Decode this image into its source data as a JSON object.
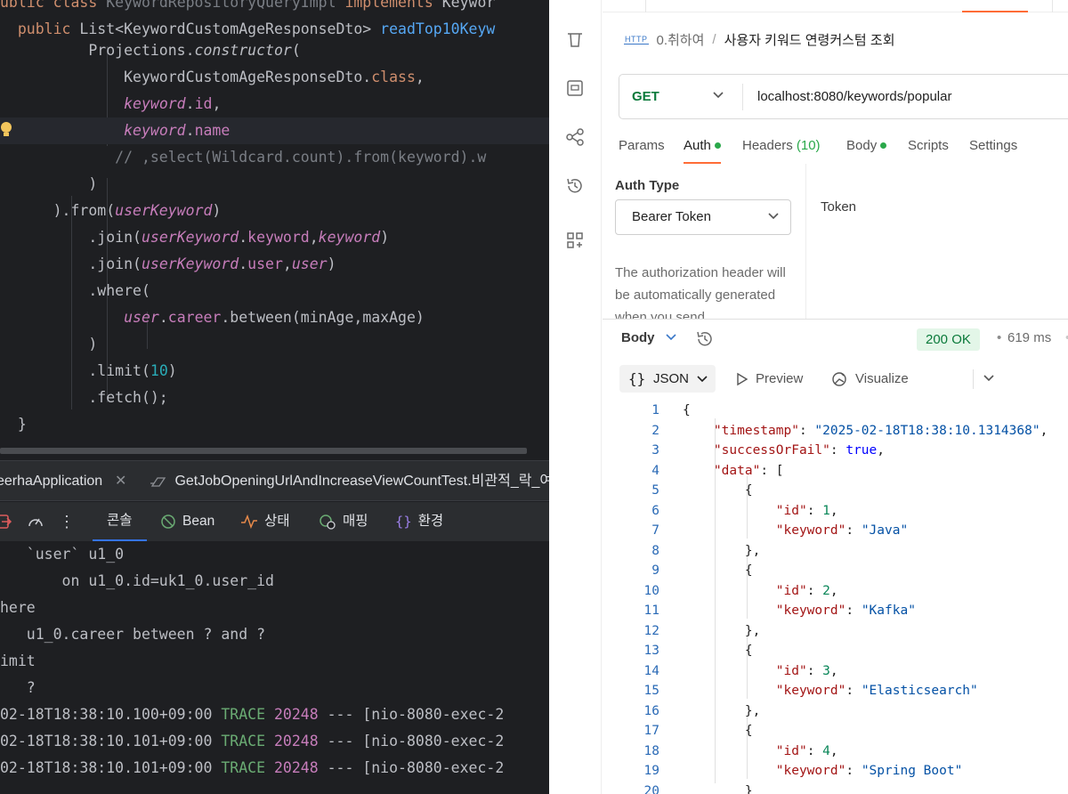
{
  "ide": {
    "code_lines": [
      {
        "parts": [
          {
            "t": "ublic ",
            "c": "kw"
          },
          {
            "t": "class ",
            "c": "kw"
          },
          {
            "t": "KeywordRepositoryQueryImpl ",
            "c": "cmt"
          },
          {
            "t": "implements ",
            "c": "kw"
          },
          {
            "t": "Keywor",
            "c": ""
          }
        ]
      },
      {
        "parts": [
          {
            "t": "  public ",
            "c": "kw"
          },
          {
            "t": "List<KeywordCustomAgeResponseDto> ",
            "c": ""
          },
          {
            "t": "readTop10Keyw",
            "c": "fn"
          }
        ]
      },
      {
        "parts": [
          {
            "t": "          Projections.",
            "c": ""
          },
          {
            "t": "constructor",
            "c": "it"
          },
          {
            "t": "(",
            "c": ""
          }
        ]
      },
      {
        "parts": [
          {
            "t": "              KeywordCustomAgeResponseDto.",
            "c": ""
          },
          {
            "t": "class",
            "c": "kw"
          },
          {
            "t": ",",
            "c": ""
          }
        ]
      },
      {
        "parts": [
          {
            "t": "              ",
            "c": ""
          },
          {
            "t": "keyword",
            "c": "fld"
          },
          {
            "t": ".",
            "c": ""
          },
          {
            "t": "id",
            "c": "fld2"
          },
          {
            "t": ",",
            "c": ""
          }
        ]
      },
      {
        "parts": [
          {
            "t": "              ",
            "c": ""
          },
          {
            "t": "keyword",
            "c": "fld"
          },
          {
            "t": ".",
            "c": ""
          },
          {
            "t": "name",
            "c": "fld2"
          }
        ]
      },
      {
        "parts": [
          {
            "t": "             // ,select(Wildcard.count).from(keyword).w",
            "c": "cmt"
          }
        ]
      },
      {
        "parts": [
          {
            "t": "          )",
            "c": ""
          }
        ]
      },
      {
        "parts": [
          {
            "t": "      ).from(",
            "c": ""
          },
          {
            "t": "userKeyword",
            "c": "fld"
          },
          {
            "t": ")",
            "c": ""
          }
        ]
      },
      {
        "parts": [
          {
            "t": "          .join(",
            "c": ""
          },
          {
            "t": "userKeyword",
            "c": "fld"
          },
          {
            "t": ".",
            "c": ""
          },
          {
            "t": "keyword",
            "c": "fld2"
          },
          {
            "t": ",",
            "c": ""
          },
          {
            "t": "keyword",
            "c": "fld"
          },
          {
            "t": ")",
            "c": ""
          }
        ]
      },
      {
        "parts": [
          {
            "t": "          .join(",
            "c": ""
          },
          {
            "t": "userKeyword",
            "c": "fld"
          },
          {
            "t": ".",
            "c": ""
          },
          {
            "t": "user",
            "c": "fld2"
          },
          {
            "t": ",",
            "c": ""
          },
          {
            "t": "user",
            "c": "fld"
          },
          {
            "t": ")",
            "c": ""
          }
        ]
      },
      {
        "parts": [
          {
            "t": "          .where(",
            "c": ""
          }
        ]
      },
      {
        "parts": [
          {
            "t": "              ",
            "c": ""
          },
          {
            "t": "user",
            "c": "fld"
          },
          {
            "t": ".",
            "c": ""
          },
          {
            "t": "career",
            "c": "fld2"
          },
          {
            "t": ".between(minAge,maxAge)",
            "c": ""
          }
        ]
      },
      {
        "parts": [
          {
            "t": "          )",
            "c": ""
          }
        ]
      },
      {
        "parts": [
          {
            "t": "          .limit(",
            "c": ""
          },
          {
            "t": "10",
            "c": "num"
          },
          {
            "t": ")",
            "c": ""
          }
        ]
      },
      {
        "parts": [
          {
            "t": "          .fetch();",
            "c": ""
          }
        ]
      },
      {
        "parts": [
          {
            "t": "  }",
            "c": ""
          }
        ]
      }
    ],
    "run_tabs": [
      "eerhaApplication",
      "GetJobOpeningUrlAndIncreaseViewCountTest.비관적_락_여러_"
    ],
    "toolbar_tabs": [
      "콘솔",
      "Bean",
      "상태",
      "매핑",
      "환경"
    ],
    "console_lines": [
      {
        "parts": [
          {
            "t": "   `user` u1_0",
            "c": ""
          }
        ]
      },
      {
        "parts": [
          {
            "t": "       on u1_0.id=uk1_0.user_id",
            "c": ""
          }
        ]
      },
      {
        "parts": [
          {
            "t": "here",
            "c": ""
          }
        ]
      },
      {
        "parts": [
          {
            "t": "   u1_0.career between ? and ?",
            "c": ""
          }
        ]
      },
      {
        "parts": [
          {
            "t": "imit",
            "c": ""
          }
        ]
      },
      {
        "parts": [
          {
            "t": "   ?",
            "c": ""
          }
        ]
      },
      {
        "parts": [
          {
            "t": "02-18T18:38:10.100+09:00 ",
            "c": ""
          },
          {
            "t": "TRACE ",
            "c": "trace"
          },
          {
            "t": "20248 ",
            "c": "pid"
          },
          {
            "t": "--- [nio-8080-exec-2",
            "c": ""
          }
        ]
      },
      {
        "parts": [
          {
            "t": "02-18T18:38:10.101+09:00 ",
            "c": ""
          },
          {
            "t": "TRACE ",
            "c": "trace"
          },
          {
            "t": "20248 ",
            "c": "pid"
          },
          {
            "t": "--- [nio-8080-exec-2",
            "c": ""
          }
        ]
      },
      {
        "parts": [
          {
            "t": "02-18T18:38:10.101+09:00 ",
            "c": ""
          },
          {
            "t": "TRACE ",
            "c": "trace"
          },
          {
            "t": "20248 ",
            "c": "pid"
          },
          {
            "t": "--- [nio-8080-exec-2",
            "c": ""
          }
        ]
      }
    ]
  },
  "postman": {
    "breadcrumb": {
      "badge": "HTTP",
      "parent": "0.취하여",
      "slash": "/",
      "current": "사용자 키워드 연령커스텀 조회"
    },
    "request": {
      "method": "GET",
      "url": "localhost:8080/keywords/popular"
    },
    "tabs": {
      "params": "Params",
      "auth": "Auth",
      "headers": "Headers",
      "headers_count": "(10)",
      "body": "Body",
      "scripts": "Scripts",
      "settings": "Settings"
    },
    "auth": {
      "type_label": "Auth Type",
      "type_value": "Bearer Token",
      "description": "The authorization header will be automatically generated when you send",
      "token_label": "Token"
    },
    "response": {
      "body_tab": "Body",
      "status": "200 OK",
      "dot": "•",
      "time": "619 ms",
      "format": "JSON",
      "preview": "Preview",
      "visualize": "Visualize"
    },
    "json_lines": [
      {
        "n": "1",
        "parts": [
          {
            "t": "{",
            "c": ""
          }
        ]
      },
      {
        "n": "2",
        "parts": [
          {
            "t": "    ",
            "c": ""
          },
          {
            "t": "\"timestamp\"",
            "c": "jk"
          },
          {
            "t": ": ",
            "c": ""
          },
          {
            "t": "\"2025-02-18T18:38:10.1314368\"",
            "c": "js"
          },
          {
            "t": ",",
            "c": ""
          }
        ]
      },
      {
        "n": "3",
        "parts": [
          {
            "t": "    ",
            "c": ""
          },
          {
            "t": "\"successOrFail\"",
            "c": "jk"
          },
          {
            "t": ": ",
            "c": ""
          },
          {
            "t": "true",
            "c": "jb"
          },
          {
            "t": ",",
            "c": ""
          }
        ]
      },
      {
        "n": "4",
        "parts": [
          {
            "t": "    ",
            "c": ""
          },
          {
            "t": "\"data\"",
            "c": "jk"
          },
          {
            "t": ": [",
            "c": ""
          }
        ]
      },
      {
        "n": "5",
        "parts": [
          {
            "t": "        {",
            "c": ""
          }
        ]
      },
      {
        "n": "6",
        "parts": [
          {
            "t": "            ",
            "c": ""
          },
          {
            "t": "\"id\"",
            "c": "jk"
          },
          {
            "t": ": ",
            "c": ""
          },
          {
            "t": "1",
            "c": "jn"
          },
          {
            "t": ",",
            "c": ""
          }
        ]
      },
      {
        "n": "7",
        "parts": [
          {
            "t": "            ",
            "c": ""
          },
          {
            "t": "\"keyword\"",
            "c": "jk"
          },
          {
            "t": ": ",
            "c": ""
          },
          {
            "t": "\"Java\"",
            "c": "js"
          }
        ]
      },
      {
        "n": "8",
        "parts": [
          {
            "t": "        },",
            "c": ""
          }
        ]
      },
      {
        "n": "9",
        "parts": [
          {
            "t": "        {",
            "c": ""
          }
        ]
      },
      {
        "n": "10",
        "parts": [
          {
            "t": "            ",
            "c": ""
          },
          {
            "t": "\"id\"",
            "c": "jk"
          },
          {
            "t": ": ",
            "c": ""
          },
          {
            "t": "2",
            "c": "jn"
          },
          {
            "t": ",",
            "c": ""
          }
        ]
      },
      {
        "n": "11",
        "parts": [
          {
            "t": "            ",
            "c": ""
          },
          {
            "t": "\"keyword\"",
            "c": "jk"
          },
          {
            "t": ": ",
            "c": ""
          },
          {
            "t": "\"Kafka\"",
            "c": "js"
          }
        ]
      },
      {
        "n": "12",
        "parts": [
          {
            "t": "        },",
            "c": ""
          }
        ]
      },
      {
        "n": "13",
        "parts": [
          {
            "t": "        {",
            "c": ""
          }
        ]
      },
      {
        "n": "14",
        "parts": [
          {
            "t": "            ",
            "c": ""
          },
          {
            "t": "\"id\"",
            "c": "jk"
          },
          {
            "t": ": ",
            "c": ""
          },
          {
            "t": "3",
            "c": "jn"
          },
          {
            "t": ",",
            "c": ""
          }
        ]
      },
      {
        "n": "15",
        "parts": [
          {
            "t": "            ",
            "c": ""
          },
          {
            "t": "\"keyword\"",
            "c": "jk"
          },
          {
            "t": ": ",
            "c": ""
          },
          {
            "t": "\"Elasticsearch\"",
            "c": "js"
          }
        ]
      },
      {
        "n": "16",
        "parts": [
          {
            "t": "        },",
            "c": ""
          }
        ]
      },
      {
        "n": "17",
        "parts": [
          {
            "t": "        {",
            "c": ""
          }
        ]
      },
      {
        "n": "18",
        "parts": [
          {
            "t": "            ",
            "c": ""
          },
          {
            "t": "\"id\"",
            "c": "jk"
          },
          {
            "t": ": ",
            "c": ""
          },
          {
            "t": "4",
            "c": "jn"
          },
          {
            "t": ",",
            "c": ""
          }
        ]
      },
      {
        "n": "19",
        "parts": [
          {
            "t": "            ",
            "c": ""
          },
          {
            "t": "\"keyword\"",
            "c": "jk"
          },
          {
            "t": ": ",
            "c": ""
          },
          {
            "t": "\"Spring Boot\"",
            "c": "js"
          }
        ]
      },
      {
        "n": "20",
        "parts": [
          {
            "t": "        }",
            "c": ""
          }
        ]
      }
    ]
  }
}
